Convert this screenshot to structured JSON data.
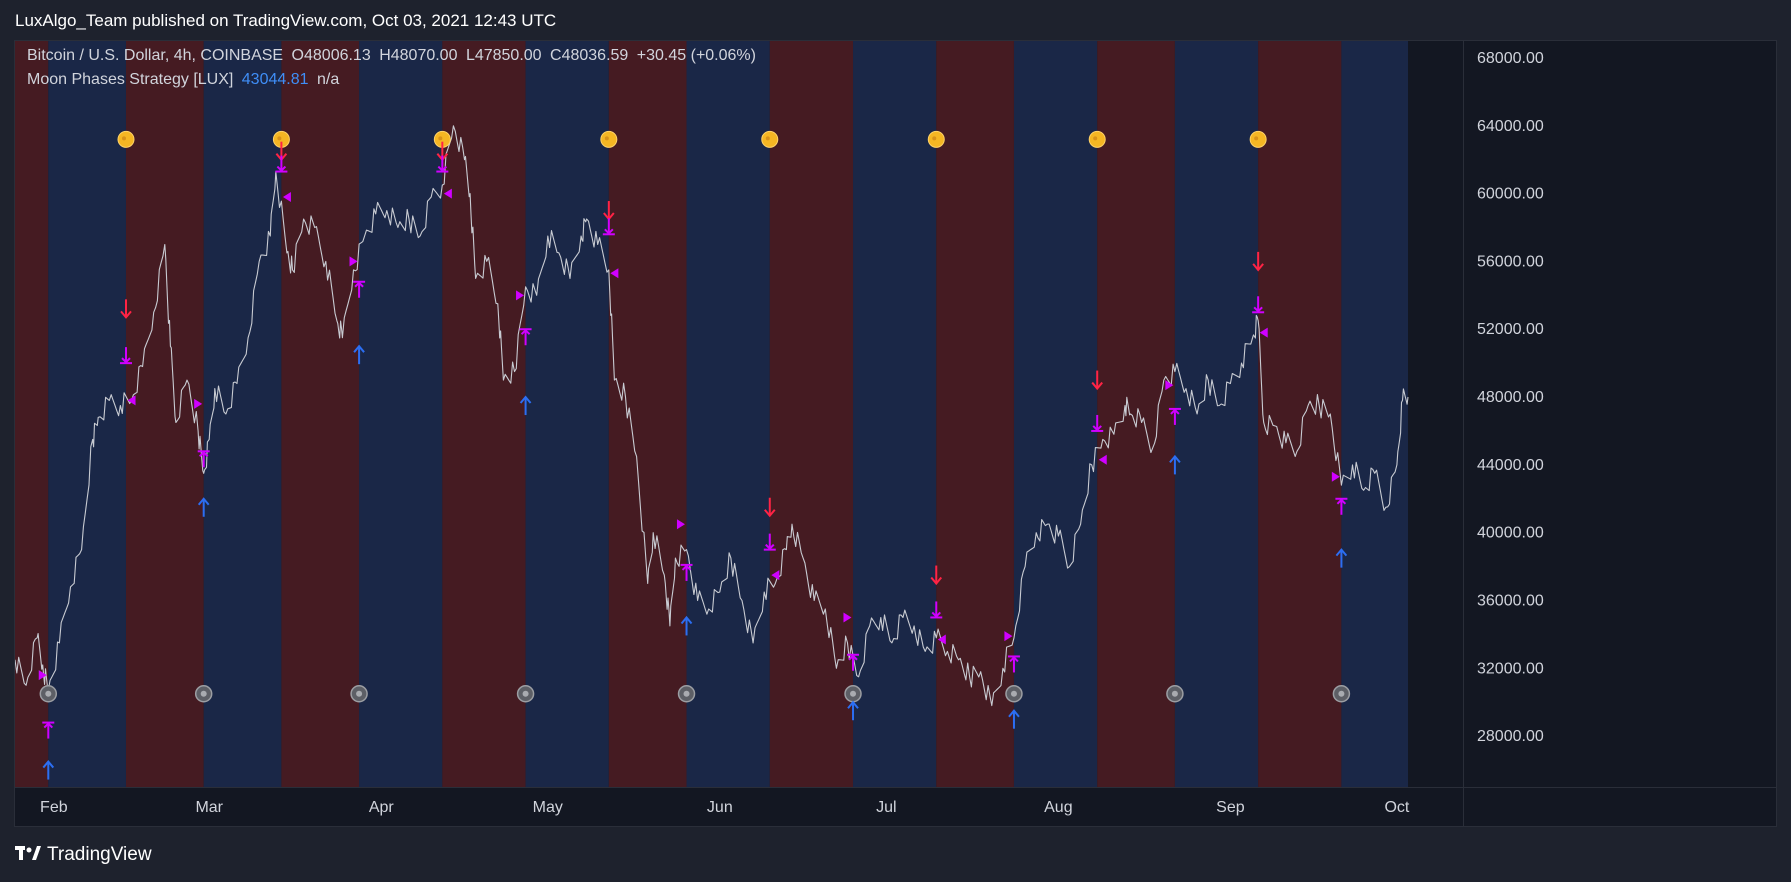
{
  "header": {
    "published": "LuxAlgo_Team published on TradingView.com, Oct 03, 2021 12:43 UTC"
  },
  "legend": {
    "symbol": "Bitcoin / U.S. Dollar, 4h, COINBASE",
    "open": "O48006.13",
    "high": "H48070.00",
    "low": "L47850.00",
    "close": "C48036.59",
    "change": "+30.45 (+0.06%)",
    "study_name": "Moon Phases Strategy [LUX]",
    "study_value": "43044.81",
    "study_na": "n/a"
  },
  "footer": {
    "brand": "TradingView",
    "logo_icon": "tradingview-logo-icon"
  },
  "colors": {
    "background": "#131722",
    "band_red": "#451b22",
    "band_blue": "#1a2747",
    "price_line": "#c8cbd2",
    "full_moon": "#f5b623",
    "new_moon": "#9c9ea3",
    "sell_arrow": "#ff2345",
    "buy_arrow": "#2c6ef2",
    "marker": "#d000ff"
  },
  "chart_data": {
    "type": "line",
    "title": "",
    "xlabel": "",
    "ylabel": "",
    "ylim": [
      25000,
      69000
    ],
    "y_ticks": [
      28000,
      32000,
      36000,
      40000,
      44000,
      48000,
      52000,
      56000,
      60000,
      64000,
      68000
    ],
    "y_tick_labels": [
      "28000.00",
      "32000.00",
      "36000.00",
      "40000.00",
      "44000.00",
      "48000.00",
      "52000.00",
      "56000.00",
      "60000.00",
      "64000.00",
      "68000.00"
    ],
    "x_domain": [
      "2021-01-25",
      "2021-10-12"
    ],
    "x_ticks": [
      {
        "date": "2021-02-01",
        "label": "Feb"
      },
      {
        "date": "2021-03-01",
        "label": "Mar"
      },
      {
        "date": "2021-04-01",
        "label": "Apr"
      },
      {
        "date": "2021-05-01",
        "label": "May"
      },
      {
        "date": "2021-06-01",
        "label": "Jun"
      },
      {
        "date": "2021-07-01",
        "label": "Jul"
      },
      {
        "date": "2021-08-01",
        "label": "Aug"
      },
      {
        "date": "2021-09-01",
        "label": "Sep"
      },
      {
        "date": "2021-10-01",
        "label": "Oct"
      }
    ],
    "phase_bands": [
      {
        "start": "2021-01-25",
        "end": "2021-01-31",
        "phase": "red"
      },
      {
        "start": "2021-01-31",
        "end": "2021-02-14",
        "phase": "blue"
      },
      {
        "start": "2021-02-14",
        "end": "2021-02-28",
        "phase": "red"
      },
      {
        "start": "2021-02-28",
        "end": "2021-03-14",
        "phase": "blue"
      },
      {
        "start": "2021-03-14",
        "end": "2021-03-28",
        "phase": "red"
      },
      {
        "start": "2021-03-28",
        "end": "2021-04-12",
        "phase": "blue"
      },
      {
        "start": "2021-04-12",
        "end": "2021-04-27",
        "phase": "red"
      },
      {
        "start": "2021-04-27",
        "end": "2021-05-12",
        "phase": "blue"
      },
      {
        "start": "2021-05-12",
        "end": "2021-05-26",
        "phase": "red"
      },
      {
        "start": "2021-05-26",
        "end": "2021-06-10",
        "phase": "blue"
      },
      {
        "start": "2021-06-10",
        "end": "2021-06-25",
        "phase": "red"
      },
      {
        "start": "2021-06-25",
        "end": "2021-07-10",
        "phase": "blue"
      },
      {
        "start": "2021-07-10",
        "end": "2021-07-24",
        "phase": "red"
      },
      {
        "start": "2021-07-24",
        "end": "2021-08-08",
        "phase": "blue"
      },
      {
        "start": "2021-08-08",
        "end": "2021-08-22",
        "phase": "red"
      },
      {
        "start": "2021-08-22",
        "end": "2021-09-06",
        "phase": "blue"
      },
      {
        "start": "2021-09-06",
        "end": "2021-09-21",
        "phase": "red"
      },
      {
        "start": "2021-09-21",
        "end": "2021-10-03",
        "phase": "blue"
      }
    ],
    "full_moons": [
      "2021-02-14",
      "2021-03-14",
      "2021-04-12",
      "2021-05-12",
      "2021-06-10",
      "2021-07-10",
      "2021-08-08",
      "2021-09-06"
    ],
    "full_moon_price": 63200,
    "new_moons": [
      "2021-01-31",
      "2021-02-28",
      "2021-03-28",
      "2021-04-27",
      "2021-05-26",
      "2021-06-25",
      "2021-07-24",
      "2021-08-22",
      "2021-09-21"
    ],
    "new_moon_price": 30500,
    "series": [
      {
        "values": [
          [
            "2021-01-25",
            32500
          ],
          [
            "2021-01-27",
            31000
          ],
          [
            "2021-01-29",
            33800
          ],
          [
            "2021-01-30",
            32200
          ],
          [
            "2021-01-31",
            30700
          ],
          [
            "2021-02-02",
            33500
          ],
          [
            "2021-02-04",
            36800
          ],
          [
            "2021-02-06",
            39000
          ],
          [
            "2021-02-08",
            45500
          ],
          [
            "2021-02-09",
            46800
          ],
          [
            "2021-02-11",
            47800
          ],
          [
            "2021-02-13",
            47500
          ],
          [
            "2021-02-15",
            47800
          ],
          [
            "2021-02-17",
            49800
          ],
          [
            "2021-02-19",
            53000
          ],
          [
            "2021-02-21",
            57000
          ],
          [
            "2021-02-22",
            51000
          ],
          [
            "2021-02-23",
            46500
          ],
          [
            "2021-02-25",
            49000
          ],
          [
            "2021-02-27",
            46000
          ],
          [
            "2021-02-28",
            43500
          ],
          [
            "2021-03-01",
            45500
          ],
          [
            "2021-03-02",
            48500
          ],
          [
            "2021-03-04",
            47000
          ],
          [
            "2021-03-06",
            48800
          ],
          [
            "2021-03-08",
            51500
          ],
          [
            "2021-03-10",
            56000
          ],
          [
            "2021-03-12",
            57500
          ],
          [
            "2021-03-13",
            61300
          ],
          [
            "2021-03-15",
            56500
          ],
          [
            "2021-03-16",
            55500
          ],
          [
            "2021-03-18",
            58500
          ],
          [
            "2021-03-20",
            58000
          ],
          [
            "2021-03-22",
            56000
          ],
          [
            "2021-03-24",
            52500
          ],
          [
            "2021-03-25",
            51500
          ],
          [
            "2021-03-27",
            55500
          ],
          [
            "2021-03-29",
            57500
          ],
          [
            "2021-03-31",
            58800
          ],
          [
            "2021-04-02",
            59000
          ],
          [
            "2021-04-04",
            58000
          ],
          [
            "2021-04-06",
            58500
          ],
          [
            "2021-04-08",
            57500
          ],
          [
            "2021-04-10",
            59800
          ],
          [
            "2021-04-12",
            60500
          ],
          [
            "2021-04-14",
            64000
          ],
          [
            "2021-04-16",
            62000
          ],
          [
            "2021-04-17",
            60000
          ],
          [
            "2021-04-18",
            55000
          ],
          [
            "2021-04-20",
            56000
          ],
          [
            "2021-04-22",
            53500
          ],
          [
            "2021-04-23",
            49000
          ],
          [
            "2021-04-25",
            49500
          ],
          [
            "2021-04-27",
            54500
          ],
          [
            "2021-04-29",
            54000
          ],
          [
            "2021-05-01",
            57500
          ],
          [
            "2021-05-03",
            56500
          ],
          [
            "2021-05-05",
            55000
          ],
          [
            "2021-05-07",
            57500
          ],
          [
            "2021-05-08",
            58500
          ],
          [
            "2021-05-10",
            57000
          ],
          [
            "2021-05-12",
            55500
          ],
          [
            "2021-05-13",
            49000
          ],
          [
            "2021-05-15",
            48000
          ],
          [
            "2021-05-17",
            44500
          ],
          [
            "2021-05-19",
            37000
          ],
          [
            "2021-05-20",
            40000
          ],
          [
            "2021-05-22",
            37500
          ],
          [
            "2021-05-23",
            34500
          ],
          [
            "2021-05-24",
            38500
          ],
          [
            "2021-05-26",
            39000
          ],
          [
            "2021-05-28",
            36000
          ],
          [
            "2021-05-30",
            35500
          ],
          [
            "2021-06-01",
            36500
          ],
          [
            "2021-06-03",
            38500
          ],
          [
            "2021-06-05",
            36000
          ],
          [
            "2021-06-07",
            33500
          ],
          [
            "2021-06-09",
            36500
          ],
          [
            "2021-06-11",
            37000
          ],
          [
            "2021-06-13",
            39000
          ],
          [
            "2021-06-14",
            40500
          ],
          [
            "2021-06-16",
            38500
          ],
          [
            "2021-06-18",
            36000
          ],
          [
            "2021-06-20",
            35500
          ],
          [
            "2021-06-22",
            32000
          ],
          [
            "2021-06-24",
            33500
          ],
          [
            "2021-06-26",
            31500
          ],
          [
            "2021-06-28",
            34500
          ],
          [
            "2021-06-30",
            35000
          ],
          [
            "2021-07-02",
            33500
          ],
          [
            "2021-07-04",
            35000
          ],
          [
            "2021-07-06",
            34500
          ],
          [
            "2021-07-08",
            33000
          ],
          [
            "2021-07-10",
            33800
          ],
          [
            "2021-07-12",
            33000
          ],
          [
            "2021-07-14",
            32500
          ],
          [
            "2021-07-16",
            31500
          ],
          [
            "2021-07-18",
            31800
          ],
          [
            "2021-07-20",
            29800
          ],
          [
            "2021-07-22",
            32000
          ],
          [
            "2021-07-24",
            33800
          ],
          [
            "2021-07-26",
            38000
          ],
          [
            "2021-07-28",
            40000
          ],
          [
            "2021-07-30",
            40500
          ],
          [
            "2021-08-01",
            39800
          ],
          [
            "2021-08-03",
            38000
          ],
          [
            "2021-08-05",
            40500
          ],
          [
            "2021-08-07",
            44000
          ],
          [
            "2021-08-09",
            45500
          ],
          [
            "2021-08-11",
            45800
          ],
          [
            "2021-08-13",
            47500
          ],
          [
            "2021-08-14",
            47000
          ],
          [
            "2021-08-16",
            46500
          ],
          [
            "2021-08-18",
            45000
          ],
          [
            "2021-08-20",
            49000
          ],
          [
            "2021-08-22",
            49500
          ],
          [
            "2021-08-24",
            48500
          ],
          [
            "2021-08-26",
            47000
          ],
          [
            "2021-08-28",
            49000
          ],
          [
            "2021-08-30",
            47500
          ],
          [
            "2021-09-01",
            48800
          ],
          [
            "2021-09-03",
            50000
          ],
          [
            "2021-09-05",
            51500
          ],
          [
            "2021-09-06",
            52500
          ],
          [
            "2021-09-07",
            46500
          ],
          [
            "2021-09-09",
            46300
          ],
          [
            "2021-09-11",
            45300
          ],
          [
            "2021-09-13",
            44800
          ],
          [
            "2021-09-15",
            47500
          ],
          [
            "2021-09-17",
            47500
          ],
          [
            "2021-09-19",
            47000
          ],
          [
            "2021-09-21",
            42800
          ],
          [
            "2021-09-23",
            44000
          ],
          [
            "2021-09-25",
            42500
          ],
          [
            "2021-09-27",
            43500
          ],
          [
            "2021-09-29",
            41500
          ],
          [
            "2021-10-01",
            44000
          ],
          [
            "2021-10-02",
            47800
          ],
          [
            "2021-10-03",
            48000
          ]
        ]
      }
    ],
    "sell_signals": [
      [
        "2021-02-14",
        52700
      ],
      [
        "2021-03-14",
        62000
      ],
      [
        "2021-04-12",
        62000
      ],
      [
        "2021-05-12",
        58500
      ],
      [
        "2021-06-10",
        41000
      ],
      [
        "2021-07-10",
        37000
      ],
      [
        "2021-08-08",
        48500
      ],
      [
        "2021-09-06",
        55500
      ]
    ],
    "buy_signals": [
      [
        "2021-01-31",
        26500
      ],
      [
        "2021-02-28",
        42000
      ],
      [
        "2021-03-28",
        51000
      ],
      [
        "2021-04-27",
        48000
      ],
      [
        "2021-05-26",
        35000
      ],
      [
        "2021-06-25",
        30000
      ],
      [
        "2021-07-24",
        29500
      ],
      [
        "2021-08-22",
        44500
      ],
      [
        "2021-09-21",
        39000
      ]
    ],
    "stop_down_markers": [
      [
        "2021-02-14",
        50000
      ],
      [
        "2021-03-14",
        61300
      ],
      [
        "2021-04-12",
        61300
      ],
      [
        "2021-05-12",
        57600
      ],
      [
        "2021-06-10",
        39000
      ],
      [
        "2021-07-10",
        35000
      ],
      [
        "2021-08-08",
        46000
      ],
      [
        "2021-09-06",
        53000
      ]
    ],
    "stop_up_markers": [
      [
        "2021-01-31",
        28800
      ],
      [
        "2021-02-28",
        44800
      ],
      [
        "2021-03-28",
        54800
      ],
      [
        "2021-04-27",
        52000
      ],
      [
        "2021-05-26",
        38100
      ],
      [
        "2021-06-25",
        32800
      ],
      [
        "2021-07-24",
        32700
      ],
      [
        "2021-08-22",
        47300
      ],
      [
        "2021-09-21",
        42000
      ]
    ],
    "triangle_right": [
      [
        "2021-01-30",
        31600
      ],
      [
        "2021-02-27",
        47600
      ],
      [
        "2021-03-27",
        56000
      ],
      [
        "2021-04-26",
        54000
      ],
      [
        "2021-05-25",
        40500
      ],
      [
        "2021-06-24",
        35000
      ],
      [
        "2021-07-23",
        33900
      ],
      [
        "2021-08-21",
        48700
      ],
      [
        "2021-09-20",
        43300
      ]
    ],
    "triangle_left": [
      [
        "2021-02-15",
        47800
      ],
      [
        "2021-03-15",
        59800
      ],
      [
        "2021-04-13",
        60000
      ],
      [
        "2021-05-13",
        55300
      ],
      [
        "2021-06-11",
        37500
      ],
      [
        "2021-07-11",
        33700
      ],
      [
        "2021-08-09",
        44300
      ],
      [
        "2021-09-07",
        51800
      ]
    ]
  }
}
